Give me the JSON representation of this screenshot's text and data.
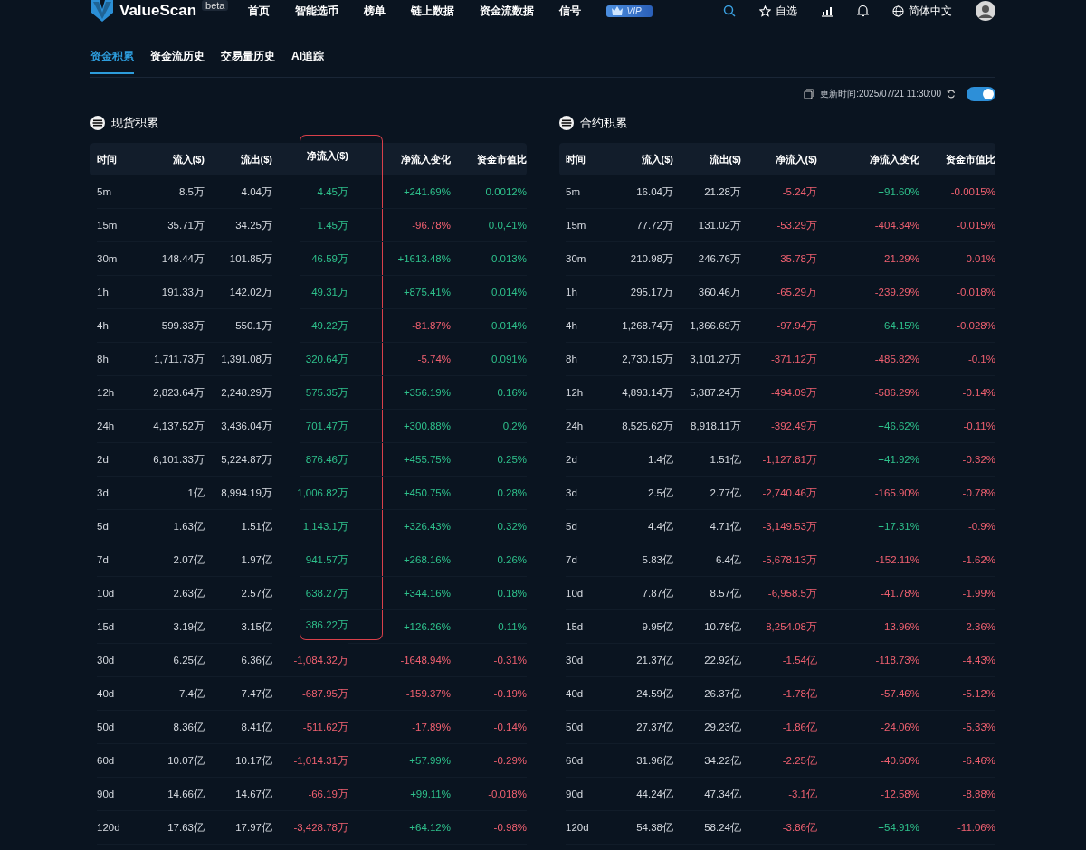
{
  "nav": {
    "brand": "ValueScan",
    "badge": "beta",
    "items": [
      "首页",
      "智能选币",
      "榜单",
      "链上数据",
      "资金流数据",
      "信号"
    ],
    "vip": "VIP",
    "watchlist": "自选",
    "language": "简体中文"
  },
  "tabs": [
    {
      "label": "资金积累",
      "selected": true
    },
    {
      "label": "资金流历史",
      "selected": false
    },
    {
      "label": "交易量历史",
      "selected": false
    },
    {
      "label": "AI追踪",
      "selected": false
    }
  ],
  "update": {
    "text": "更新时间:2025/07/21 11:30:00",
    "auto_refresh": true
  },
  "tables": [
    {
      "title": "现货积累",
      "columns": [
        "时间",
        "流入($)",
        "流出($)",
        "净流入($)",
        "净流入变化",
        "资金市值比"
      ],
      "rows": [
        {
          "time": "5m",
          "inflow": "8.5万",
          "outflow": "4.04万",
          "net": "4.45万",
          "net_up": true,
          "change": "+241.69%",
          "change_up": true,
          "ratio": "0.0012%",
          "ratio_up": true,
          "highlighted": true
        },
        {
          "time": "15m",
          "inflow": "35.71万",
          "outflow": "34.25万",
          "net": "1.45万",
          "net_up": true,
          "change": "-96.78%",
          "change_up": false,
          "ratio": "0.0,41%",
          "ratio_up": true,
          "highlighted": true
        },
        {
          "time": "30m",
          "inflow": "148.44万",
          "outflow": "101.85万",
          "net": "46.59万",
          "net_up": true,
          "change": "+1613.48%",
          "change_up": true,
          "ratio": "0.013%",
          "ratio_up": true,
          "highlighted": true
        },
        {
          "time": "1h",
          "inflow": "191.33万",
          "outflow": "142.02万",
          "net": "49.31万",
          "net_up": true,
          "change": "+875.41%",
          "change_up": true,
          "ratio": "0.014%",
          "ratio_up": true,
          "highlighted": true
        },
        {
          "time": "4h",
          "inflow": "599.33万",
          "outflow": "550.1万",
          "net": "49.22万",
          "net_up": true,
          "change": "-81.87%",
          "change_up": false,
          "ratio": "0.014%",
          "ratio_up": true,
          "highlighted": true
        },
        {
          "time": "8h",
          "inflow": "1,711.73万",
          "outflow": "1,391.08万",
          "net": "320.64万",
          "net_up": true,
          "change": "-5.74%",
          "change_up": false,
          "ratio": "0.091%",
          "ratio_up": true,
          "highlighted": true
        },
        {
          "time": "12h",
          "inflow": "2,823.64万",
          "outflow": "2,248.29万",
          "net": "575.35万",
          "net_up": true,
          "change": "+356.19%",
          "change_up": true,
          "ratio": "0.16%",
          "ratio_up": true,
          "highlighted": true
        },
        {
          "time": "24h",
          "inflow": "4,137.52万",
          "outflow": "3,436.04万",
          "net": "701.47万",
          "net_up": true,
          "change": "+300.88%",
          "change_up": true,
          "ratio": "0.2%",
          "ratio_up": true,
          "highlighted": true
        },
        {
          "time": "2d",
          "inflow": "6,101.33万",
          "outflow": "5,224.87万",
          "net": "876.46万",
          "net_up": true,
          "change": "+455.75%",
          "change_up": true,
          "ratio": "0.25%",
          "ratio_up": true,
          "highlighted": true
        },
        {
          "time": "3d",
          "inflow": "1亿",
          "outflow": "8,994.19万",
          "net": "1,006.82万",
          "net_up": true,
          "change": "+450.75%",
          "change_up": true,
          "ratio": "0.28%",
          "ratio_up": true,
          "highlighted": true
        },
        {
          "time": "5d",
          "inflow": "1.63亿",
          "outflow": "1.51亿",
          "net": "1,143.1万",
          "net_up": true,
          "change": "+326.43%",
          "change_up": true,
          "ratio": "0.32%",
          "ratio_up": true,
          "highlighted": true
        },
        {
          "time": "7d",
          "inflow": "2.07亿",
          "outflow": "1.97亿",
          "net": "941.57万",
          "net_up": true,
          "change": "+268.16%",
          "change_up": true,
          "ratio": "0.26%",
          "ratio_up": true,
          "highlighted": true
        },
        {
          "time": "10d",
          "inflow": "2.63亿",
          "outflow": "2.57亿",
          "net": "638.27万",
          "net_up": true,
          "change": "+344.16%",
          "change_up": true,
          "ratio": "0.18%",
          "ratio_up": true,
          "highlighted": true
        },
        {
          "time": "15d",
          "inflow": "3.19亿",
          "outflow": "3.15亿",
          "net": "386.22万",
          "net_up": true,
          "change": "+126.26%",
          "change_up": true,
          "ratio": "0.11%",
          "ratio_up": true,
          "highlighted": true
        },
        {
          "time": "30d",
          "inflow": "6.25亿",
          "outflow": "6.36亿",
          "net": "-1,084.32万",
          "net_up": false,
          "change": "-1648.94%",
          "change_up": false,
          "ratio": "-0.31%",
          "ratio_up": false,
          "highlighted": false
        },
        {
          "time": "40d",
          "inflow": "7.4亿",
          "outflow": "7.47亿",
          "net": "-687.95万",
          "net_up": false,
          "change": "-159.37%",
          "change_up": false,
          "ratio": "-0.19%",
          "ratio_up": false,
          "highlighted": false
        },
        {
          "time": "50d",
          "inflow": "8.36亿",
          "outflow": "8.41亿",
          "net": "-511.62万",
          "net_up": false,
          "change": "-17.89%",
          "change_up": false,
          "ratio": "-0.14%",
          "ratio_up": false,
          "highlighted": false
        },
        {
          "time": "60d",
          "inflow": "10.07亿",
          "outflow": "10.17亿",
          "net": "-1,014.31万",
          "net_up": false,
          "change": "+57.99%",
          "change_up": true,
          "ratio": "-0.29%",
          "ratio_up": false,
          "highlighted": false
        },
        {
          "time": "90d",
          "inflow": "14.66亿",
          "outflow": "14.67亿",
          "net": "-66.19万",
          "net_up": false,
          "change": "+99.11%",
          "change_up": true,
          "ratio": "-0.018%",
          "ratio_up": false,
          "highlighted": false
        },
        {
          "time": "120d",
          "inflow": "17.63亿",
          "outflow": "17.97亿",
          "net": "-3,428.78万",
          "net_up": false,
          "change": "+64.12%",
          "change_up": true,
          "ratio": "-0.98%",
          "ratio_up": false,
          "highlighted": false
        }
      ]
    },
    {
      "title": "合约积累",
      "columns": [
        "时间",
        "流入($)",
        "流出($)",
        "净流入($)",
        "净流入变化",
        "资金市值比"
      ],
      "rows": [
        {
          "time": "5m",
          "inflow": "16.04万",
          "outflow": "21.28万",
          "net": "-5.24万",
          "net_up": false,
          "change": "+91.60%",
          "change_up": true,
          "ratio": "-0.0015%",
          "ratio_up": false
        },
        {
          "time": "15m",
          "inflow": "77.72万",
          "outflow": "131.02万",
          "net": "-53.29万",
          "net_up": false,
          "change": "-404.34%",
          "change_up": false,
          "ratio": "-0.015%",
          "ratio_up": false
        },
        {
          "time": "30m",
          "inflow": "210.98万",
          "outflow": "246.76万",
          "net": "-35.78万",
          "net_up": false,
          "change": "-21.29%",
          "change_up": false,
          "ratio": "-0.01%",
          "ratio_up": false
        },
        {
          "time": "1h",
          "inflow": "295.17万",
          "outflow": "360.46万",
          "net": "-65.29万",
          "net_up": false,
          "change": "-239.29%",
          "change_up": false,
          "ratio": "-0.018%",
          "ratio_up": false
        },
        {
          "time": "4h",
          "inflow": "1,268.74万",
          "outflow": "1,366.69万",
          "net": "-97.94万",
          "net_up": false,
          "change": "+64.15%",
          "change_up": true,
          "ratio": "-0.028%",
          "ratio_up": false
        },
        {
          "time": "8h",
          "inflow": "2,730.15万",
          "outflow": "3,101.27万",
          "net": "-371.12万",
          "net_up": false,
          "change": "-485.82%",
          "change_up": false,
          "ratio": "-0.1%",
          "ratio_up": false
        },
        {
          "time": "12h",
          "inflow": "4,893.14万",
          "outflow": "5,387.24万",
          "net": "-494.09万",
          "net_up": false,
          "change": "-586.29%",
          "change_up": false,
          "ratio": "-0.14%",
          "ratio_up": false
        },
        {
          "time": "24h",
          "inflow": "8,525.62万",
          "outflow": "8,918.11万",
          "net": "-392.49万",
          "net_up": false,
          "change": "+46.62%",
          "change_up": true,
          "ratio": "-0.11%",
          "ratio_up": false
        },
        {
          "time": "2d",
          "inflow": "1.4亿",
          "outflow": "1.51亿",
          "net": "-1,127.81万",
          "net_up": false,
          "change": "+41.92%",
          "change_up": true,
          "ratio": "-0.32%",
          "ratio_up": false
        },
        {
          "time": "3d",
          "inflow": "2.5亿",
          "outflow": "2.77亿",
          "net": "-2,740.46万",
          "net_up": false,
          "change": "-165.90%",
          "change_up": false,
          "ratio": "-0.78%",
          "ratio_up": false
        },
        {
          "time": "5d",
          "inflow": "4.4亿",
          "outflow": "4.71亿",
          "net": "-3,149.53万",
          "net_up": false,
          "change": "+17.31%",
          "change_up": true,
          "ratio": "-0.9%",
          "ratio_up": false
        },
        {
          "time": "7d",
          "inflow": "5.83亿",
          "outflow": "6.4亿",
          "net": "-5,678.13万",
          "net_up": false,
          "change": "-152.11%",
          "change_up": false,
          "ratio": "-1.62%",
          "ratio_up": false
        },
        {
          "time": "10d",
          "inflow": "7.87亿",
          "outflow": "8.57亿",
          "net": "-6,958.5万",
          "net_up": false,
          "change": "-41.78%",
          "change_up": false,
          "ratio": "-1.99%",
          "ratio_up": false
        },
        {
          "time": "15d",
          "inflow": "9.95亿",
          "outflow": "10.78亿",
          "net": "-8,254.08万",
          "net_up": false,
          "change": "-13.96%",
          "change_up": false,
          "ratio": "-2.36%",
          "ratio_up": false
        },
        {
          "time": "30d",
          "inflow": "21.37亿",
          "outflow": "22.92亿",
          "net": "-1.54亿",
          "net_up": false,
          "change": "-118.73%",
          "change_up": false,
          "ratio": "-4.43%",
          "ratio_up": false
        },
        {
          "time": "40d",
          "inflow": "24.59亿",
          "outflow": "26.37亿",
          "net": "-1.78亿",
          "net_up": false,
          "change": "-57.46%",
          "change_up": false,
          "ratio": "-5.12%",
          "ratio_up": false
        },
        {
          "time": "50d",
          "inflow": "27.37亿",
          "outflow": "29.23亿",
          "net": "-1.86亿",
          "net_up": false,
          "change": "-24.06%",
          "change_up": false,
          "ratio": "-5.33%",
          "ratio_up": false
        },
        {
          "time": "60d",
          "inflow": "31.96亿",
          "outflow": "34.22亿",
          "net": "-2.25亿",
          "net_up": false,
          "change": "-40.60%",
          "change_up": false,
          "ratio": "-6.46%",
          "ratio_up": false
        },
        {
          "time": "90d",
          "inflow": "44.24亿",
          "outflow": "47.34亿",
          "net": "-3.1亿",
          "net_up": false,
          "change": "-12.58%",
          "change_up": false,
          "ratio": "-8.88%",
          "ratio_up": false
        },
        {
          "time": "120d",
          "inflow": "54.38亿",
          "outflow": "58.24亿",
          "net": "-3.86亿",
          "net_up": false,
          "change": "+54.91%",
          "change_up": true,
          "ratio": "-11.06%",
          "ratio_up": false
        }
      ]
    }
  ]
}
